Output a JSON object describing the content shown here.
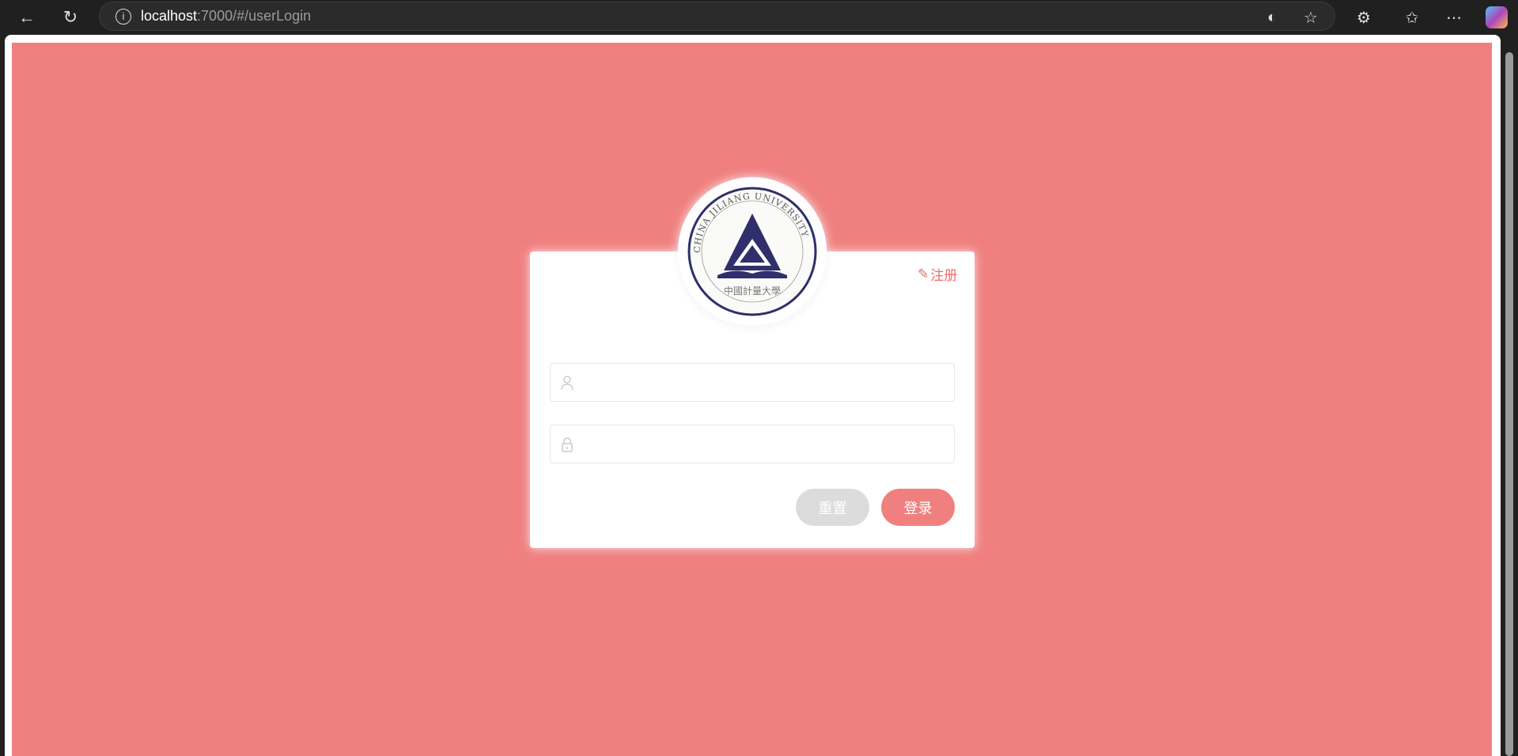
{
  "browser": {
    "url_host": "localhost",
    "url_rest": ":7000/#/userLogin"
  },
  "logo": {
    "text_top": "CHINA JILIANG UNIVERSITY",
    "text_bottom": "中國計量大學"
  },
  "card": {
    "register_label": "注册",
    "username_placeholder": "",
    "password_placeholder": "",
    "reset_label": "重置",
    "login_label": "登录"
  },
  "colors": {
    "background": "#f08080",
    "accent": "#f08080",
    "reset": "#dcdcdc",
    "logo_navy": "#2e2f6b"
  }
}
